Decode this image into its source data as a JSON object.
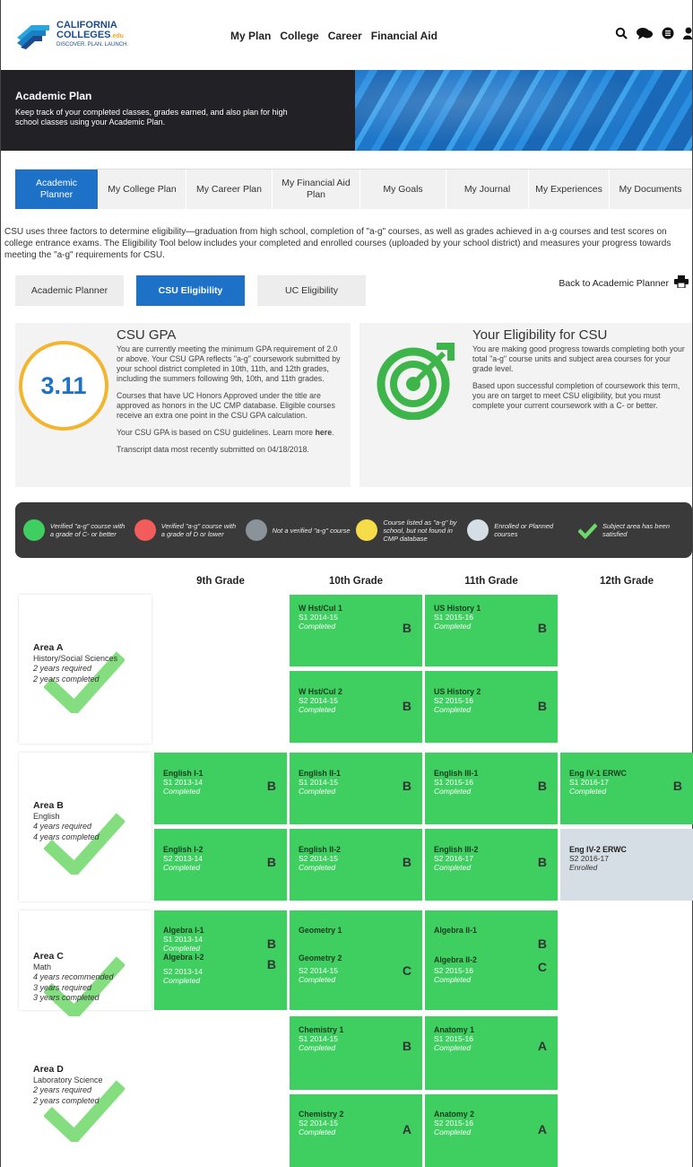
{
  "nav": {
    "logo_line1": "CALIFORNIA",
    "logo_line2": "COLLEGES",
    "logo_edu": ".edu",
    "logo_tagline": "DISCOVER. PLAN. LAUNCH.",
    "links": [
      "My Plan",
      "College",
      "Career",
      "Financial Aid"
    ],
    "icons": [
      "search-icon",
      "chat-icon",
      "list-icon",
      "user-icon"
    ]
  },
  "banner": {
    "title": "Academic Plan",
    "subtitle": "Keep track of your completed classes, grades earned, and also plan for high school classes using your Academic Plan."
  },
  "tabs": [
    "Academic Planner",
    "My College Plan",
    "My Career Plan",
    "My Financial Aid Plan",
    "My Goals",
    "My Journal",
    "My Experiences",
    "My Documents"
  ],
  "intro": "CSU uses three factors to determine eligibility—graduation from high school, completion of \"a-g\" courses, as well as grades achieved in a-g courses and test scores on college entrance exams. The Eligibility Tool below includes your completed and enrolled courses (uploaded by your school district) and measures your progress towards meeting the \"a-g\" requirements for CSU.",
  "subtabs": [
    "Academic Planner",
    "CSU Eligibility",
    "UC Eligibility"
  ],
  "back_label": "Back to Academic Planner",
  "gpa": {
    "title": "CSU GPA",
    "value": "3.11",
    "p1": "You are currently meeting the minimum GPA requirement of 2.0 or above. Your CSU GPA reflects \"a-g\" coursework submitted by your school district completed in 10th, 11th, and 12th grades, including the summers following 9th, 10th, and 11th grades.",
    "p2": "Courses that have UC Honors Approved under the title are approved as honors in the UC CMP database. Eligible courses receive an extra one point in the CSU GPA calculation.",
    "p3_prefix": "Your CSU GPA is based on CSU guidelines. Learn more ",
    "p3_link": "here",
    "p3_suffix": ".",
    "p4": "Transcript data most recently submitted on 04/18/2018."
  },
  "eligibility": {
    "title": "Your Eligibility for CSU",
    "p1": "You are making good progress towards completing both your total \"a-g\" course units and subject area courses for your grade level.",
    "p2": "Based upon successful completion of coursework this term, you are on target to meet CSU eligibility, but you must complete your current coursework with a C- or better."
  },
  "legend": [
    {
      "label": "Verified \"a-g\" course with a grade of C- or better",
      "color": "#3ecf60"
    },
    {
      "label": "Verified \"a-g\" course with a grade of D or lower",
      "color": "#f25c5c"
    },
    {
      "label": "Not a verified \"a-g\" course",
      "color": "#8a9399"
    },
    {
      "label": "Course listed as \"a-g\" by school, but not found in CMP database",
      "color": "#f7dc4a"
    },
    {
      "label": "Enrolled or Planned courses",
      "color": "#d5dee5"
    },
    {
      "label": "Subject area has been satisfied",
      "color": "#6ed86a"
    }
  ],
  "grades": [
    "9th Grade",
    "10th Grade",
    "11th Grade",
    "12th Grade"
  ],
  "areas": [
    {
      "name": "Area A",
      "subject": "History/Social Sciences",
      "lines": [
        "2 years required",
        "2 years completed"
      ]
    },
    {
      "name": "Area B",
      "subject": "English",
      "lines": [
        "4 years required",
        "4 years completed"
      ]
    },
    {
      "name": "Area C",
      "subject": "Math",
      "lines": [
        "4 years recommended",
        "3 years required",
        "3 years completed"
      ]
    },
    {
      "name": "Area D",
      "subject": "Laboratory Science",
      "lines": [
        "2 years required",
        "2 years completed"
      ]
    }
  ],
  "courses": [
    {
      "name": "W Hst/Cul 1",
      "term": "S1 2014-15",
      "status": "Completed",
      "grade": "B"
    },
    {
      "name": "US History 1",
      "term": "S1 2015-16",
      "status": "Completed",
      "grade": "B"
    },
    {
      "name": "W Hst/Cul 2",
      "term": "S2 2014-15",
      "status": "Completed",
      "grade": "B"
    },
    {
      "name": "US History 2",
      "term": "S2 2015-16",
      "status": "Completed",
      "grade": "B"
    },
    {
      "name": "English I-1",
      "term": "S1 2013-14",
      "status": "Completed",
      "grade": "B"
    },
    {
      "name": "English II-1",
      "term": "S1 2014-15",
      "status": "Completed",
      "grade": "B"
    },
    {
      "name": "English III-1",
      "term": "S1 2015-16",
      "status": "Completed",
      "grade": "B"
    },
    {
      "name": "Eng IV-1 ERWC",
      "term": "S1 2016-17",
      "status": "Completed",
      "grade": "B"
    },
    {
      "name": "English I-2",
      "term": "S2 2013-14",
      "status": "Completed",
      "grade": "B"
    },
    {
      "name": "English II-2",
      "term": "S2 2014-15",
      "status": "Completed",
      "grade": "B"
    },
    {
      "name": "English III-2",
      "term": "S2 2016-17",
      "status": "Completed",
      "grade": "B"
    },
    {
      "name": "Eng IV-2 ERWC",
      "term": "S2 2016-17",
      "status": "Enrolled",
      "grade": ""
    },
    {
      "name": "Chemistry 1",
      "term": "S1 2014-15",
      "status": "Completed",
      "grade": "B"
    },
    {
      "name": "Anatomy 1",
      "term": "S1 2015-16",
      "status": "Completed",
      "grade": "A"
    },
    {
      "name": "Chemistry 2",
      "term": "S2 2014-15",
      "status": "Completed",
      "grade": "A"
    },
    {
      "name": "Anatomy 2",
      "term": "S2 2015-16",
      "status": "Completed",
      "grade": "A"
    }
  ],
  "math": {
    "alg1": {
      "name": "Algebra I-1",
      "term": "S1 2013-14",
      "status": "Completed",
      "grade": "B"
    },
    "alg2": {
      "name": "Algebra I-2",
      "term": "S2 2013-14",
      "status": "Completed",
      "grade": "B"
    },
    "geo1": {
      "name": "Geometry 1",
      "grade": ""
    },
    "geo2": {
      "name": "Geometry 2",
      "term": "S2 2014-15",
      "status": "Completed",
      "grade": "C"
    },
    "algii1": {
      "name": "Algebra II-1",
      "grade": "B"
    },
    "algii2": {
      "name": "Algebra II-2",
      "term": "S2 2015-16",
      "status": "Completed",
      "grade": "C"
    }
  }
}
